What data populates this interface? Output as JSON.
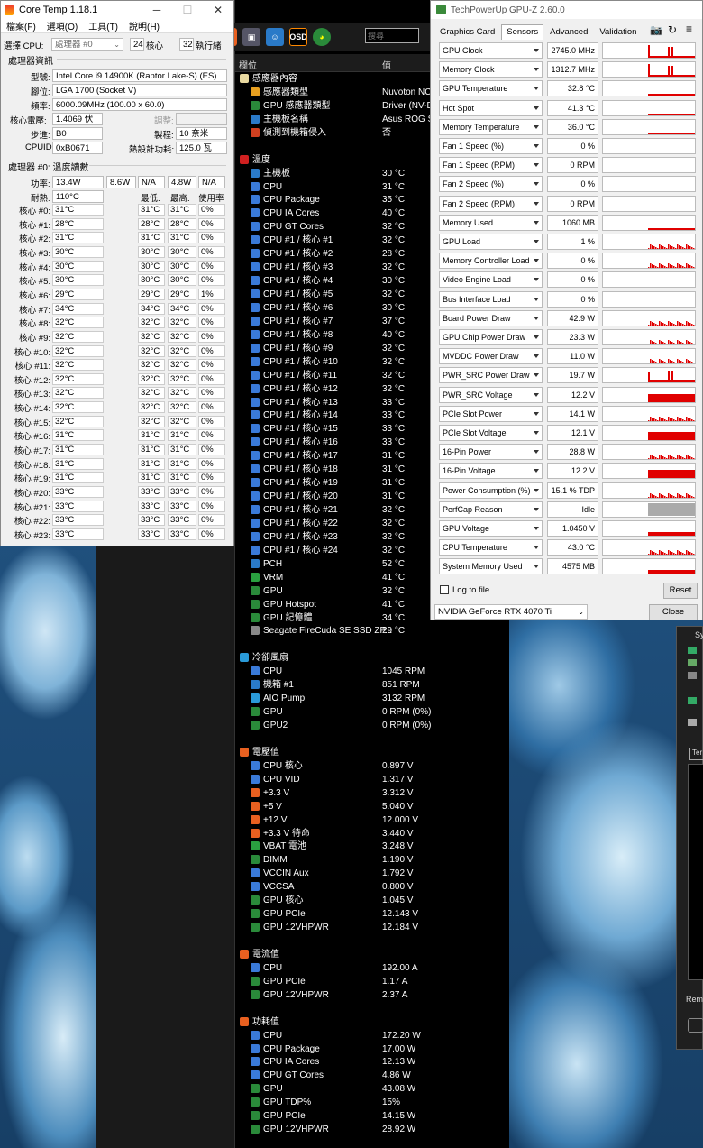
{
  "coretemp": {
    "title": "Core Temp 1.18.1",
    "menu": [
      "檔案(F)",
      "選項(O)",
      "工具(T)",
      "說明(H)"
    ],
    "select_label": "選擇 CPU:",
    "cpu_select": "處理器 #0",
    "cores": "24",
    "cores_label": "核心",
    "threads": "32",
    "threads_label": "執行緒",
    "info_header": "處理器資訊",
    "model_label": "型號:",
    "model": "Intel Core i9 14900K (Raptor Lake-S)  (ES)",
    "socket_label": "腳位:",
    "socket": "LGA 1700 (Socket V)",
    "freq_label": "頻率:",
    "freq": "6000.09MHz (100.00 x 60.0)",
    "vid_label": "核心電壓:",
    "vid": "1.4069 伏",
    "mod_label": "調整:",
    "mod": "",
    "step_label": "步進:",
    "step": "B0",
    "lith_label": "製程:",
    "lith": "10 奈米",
    "cpuid_label": "CPUID:",
    "cpuid": "0xB0671",
    "tdp_label": "熱設計功耗:",
    "tdp": "125.0 瓦",
    "temp_header": "處理器 #0: 溫度讀數",
    "power_label": "功率:",
    "power": [
      "13.4W",
      "8.6W",
      "N/A",
      "4.8W",
      "N/A"
    ],
    "tj_label": "耐熱:",
    "tj": "110°C",
    "min_label": "最低.",
    "max_label": "最高.",
    "load_label": "使用率",
    "cores_list": [
      {
        "n": "核心 #0:",
        "t": "31°C",
        "min": "31°C",
        "max": "31°C",
        "load": "0%"
      },
      {
        "n": "核心 #1:",
        "t": "28°C",
        "min": "28°C",
        "max": "28°C",
        "load": "0%"
      },
      {
        "n": "核心 #2:",
        "t": "31°C",
        "min": "31°C",
        "max": "31°C",
        "load": "0%"
      },
      {
        "n": "核心 #3:",
        "t": "30°C",
        "min": "30°C",
        "max": "30°C",
        "load": "0%"
      },
      {
        "n": "核心 #4:",
        "t": "30°C",
        "min": "30°C",
        "max": "30°C",
        "load": "0%"
      },
      {
        "n": "核心 #5:",
        "t": "30°C",
        "min": "30°C",
        "max": "30°C",
        "load": "0%"
      },
      {
        "n": "核心 #6:",
        "t": "29°C",
        "min": "29°C",
        "max": "29°C",
        "load": "1%"
      },
      {
        "n": "核心 #7:",
        "t": "34°C",
        "min": "34°C",
        "max": "34°C",
        "load": "0%"
      },
      {
        "n": "核心 #8:",
        "t": "32°C",
        "min": "32°C",
        "max": "32°C",
        "load": "0%"
      },
      {
        "n": "核心 #9:",
        "t": "32°C",
        "min": "32°C",
        "max": "32°C",
        "load": "0%"
      },
      {
        "n": "核心 #10:",
        "t": "32°C",
        "min": "32°C",
        "max": "32°C",
        "load": "0%"
      },
      {
        "n": "核心 #11:",
        "t": "32°C",
        "min": "32°C",
        "max": "32°C",
        "load": "0%"
      },
      {
        "n": "核心 #12:",
        "t": "32°C",
        "min": "32°C",
        "max": "32°C",
        "load": "0%"
      },
      {
        "n": "核心 #13:",
        "t": "32°C",
        "min": "32°C",
        "max": "32°C",
        "load": "0%"
      },
      {
        "n": "核心 #14:",
        "t": "32°C",
        "min": "32°C",
        "max": "32°C",
        "load": "0%"
      },
      {
        "n": "核心 #15:",
        "t": "32°C",
        "min": "32°C",
        "max": "32°C",
        "load": "0%"
      },
      {
        "n": "核心 #16:",
        "t": "31°C",
        "min": "31°C",
        "max": "31°C",
        "load": "0%"
      },
      {
        "n": "核心 #17:",
        "t": "31°C",
        "min": "31°C",
        "max": "31°C",
        "load": "0%"
      },
      {
        "n": "核心 #18:",
        "t": "31°C",
        "min": "31°C",
        "max": "31°C",
        "load": "0%"
      },
      {
        "n": "核心 #19:",
        "t": "31°C",
        "min": "31°C",
        "max": "31°C",
        "load": "0%"
      },
      {
        "n": "核心 #20:",
        "t": "33°C",
        "min": "33°C",
        "max": "33°C",
        "load": "0%"
      },
      {
        "n": "核心 #21:",
        "t": "33°C",
        "min": "33°C",
        "max": "33°C",
        "load": "0%"
      },
      {
        "n": "核心 #22:",
        "t": "33°C",
        "min": "33°C",
        "max": "33°C",
        "load": "0%"
      },
      {
        "n": "核心 #23:",
        "t": "33°C",
        "min": "33°C",
        "max": "33°C",
        "load": "0%"
      }
    ]
  },
  "hwinfo": {
    "search_placeholder": "搜尋",
    "col_field": "欄位",
    "col_value": "值",
    "toolbar_icons": [
      "flame-icon",
      "computer-icon",
      "user-icon",
      "osd-icon",
      "globe-icon"
    ],
    "osd_label": "OSD",
    "rows": [
      {
        "s": 1,
        "l": "感應器內容",
        "v": "",
        "c": "#e8d9a0"
      },
      {
        "l": "感應器類型",
        "v": "Nuvoton NC",
        "c": "#e8a020"
      },
      {
        "l": "GPU 感應器類型",
        "v": "Driver (NV-D",
        "c": "#2a8a3a"
      },
      {
        "l": "主機板名稱",
        "v": "Asus ROG St",
        "c": "#2a7ac8"
      },
      {
        "l": "偵測到機箱侵入",
        "v": "否",
        "c": "#d04020"
      },
      {
        "gap": 1
      },
      {
        "s": 1,
        "l": "溫度",
        "v": "",
        "c": "#d02020"
      },
      {
        "l": "主機板",
        "v": "30 °C",
        "c": "#2a7ac8"
      },
      {
        "l": "CPU",
        "v": "31 °C",
        "c": "#3a7ad8"
      },
      {
        "l": "CPU Package",
        "v": "35 °C",
        "c": "#3a7ad8"
      },
      {
        "l": "CPU IA Cores",
        "v": "40 °C",
        "c": "#3a7ad8"
      },
      {
        "l": "CPU GT Cores",
        "v": "32 °C",
        "c": "#3a7ad8"
      },
      {
        "l": "CPU #1 / 核心 #1",
        "v": "32 °C",
        "c": "#3a7ad8"
      },
      {
        "l": "CPU #1 / 核心 #2",
        "v": "28 °C",
        "c": "#3a7ad8"
      },
      {
        "l": "CPU #1 / 核心 #3",
        "v": "32 °C",
        "c": "#3a7ad8"
      },
      {
        "l": "CPU #1 / 核心 #4",
        "v": "30 °C",
        "c": "#3a7ad8"
      },
      {
        "l": "CPU #1 / 核心 #5",
        "v": "32 °C",
        "c": "#3a7ad8"
      },
      {
        "l": "CPU #1 / 核心 #6",
        "v": "30 °C",
        "c": "#3a7ad8"
      },
      {
        "l": "CPU #1 / 核心 #7",
        "v": "37 °C",
        "c": "#3a7ad8"
      },
      {
        "l": "CPU #1 / 核心 #8",
        "v": "40 °C",
        "c": "#3a7ad8"
      },
      {
        "l": "CPU #1 / 核心 #9",
        "v": "32 °C",
        "c": "#3a7ad8"
      },
      {
        "l": "CPU #1 / 核心 #10",
        "v": "32 °C",
        "c": "#3a7ad8"
      },
      {
        "l": "CPU #1 / 核心 #11",
        "v": "32 °C",
        "c": "#3a7ad8"
      },
      {
        "l": "CPU #1 / 核心 #12",
        "v": "32 °C",
        "c": "#3a7ad8"
      },
      {
        "l": "CPU #1 / 核心 #13",
        "v": "33 °C",
        "c": "#3a7ad8"
      },
      {
        "l": "CPU #1 / 核心 #14",
        "v": "33 °C",
        "c": "#3a7ad8"
      },
      {
        "l": "CPU #1 / 核心 #15",
        "v": "33 °C",
        "c": "#3a7ad8"
      },
      {
        "l": "CPU #1 / 核心 #16",
        "v": "33 °C",
        "c": "#3a7ad8"
      },
      {
        "l": "CPU #1 / 核心 #17",
        "v": "31 °C",
        "c": "#3a7ad8"
      },
      {
        "l": "CPU #1 / 核心 #18",
        "v": "31 °C",
        "c": "#3a7ad8"
      },
      {
        "l": "CPU #1 / 核心 #19",
        "v": "31 °C",
        "c": "#3a7ad8"
      },
      {
        "l": "CPU #1 / 核心 #20",
        "v": "31 °C",
        "c": "#3a7ad8"
      },
      {
        "l": "CPU #1 / 核心 #21",
        "v": "32 °C",
        "c": "#3a7ad8"
      },
      {
        "l": "CPU #1 / 核心 #22",
        "v": "32 °C",
        "c": "#3a7ad8"
      },
      {
        "l": "CPU #1 / 核心 #23",
        "v": "32 °C",
        "c": "#3a7ad8"
      },
      {
        "l": "CPU #1 / 核心 #24",
        "v": "32 °C",
        "c": "#3a7ad8"
      },
      {
        "l": "PCH",
        "v": "52 °C",
        "c": "#2a7ac8"
      },
      {
        "l": "VRM",
        "v": "41 °C",
        "c": "#2aa040"
      },
      {
        "l": "GPU",
        "v": "32 °C",
        "c": "#2a8a3a"
      },
      {
        "l": "GPU Hotspot",
        "v": "41 °C",
        "c": "#2a8a3a"
      },
      {
        "l": "GPU 記憶體",
        "v": "34 °C",
        "c": "#2a8a3a"
      },
      {
        "l": "Seagate FireCuda SE SSD ZP...",
        "v": "29 °C",
        "c": "#888"
      },
      {
        "gap": 1
      },
      {
        "s": 1,
        "l": "冷卻風扇",
        "v": "",
        "c": "#2a9ad8"
      },
      {
        "l": "CPU",
        "v": "1045 RPM",
        "c": "#3a7ad8"
      },
      {
        "l": "機箱 #1",
        "v": "851 RPM",
        "c": "#2a7ac8"
      },
      {
        "l": "AIO Pump",
        "v": "3132 RPM",
        "c": "#2a9ad8"
      },
      {
        "l": "GPU",
        "v": "0 RPM  (0%)",
        "c": "#2a8a3a"
      },
      {
        "l": "GPU2",
        "v": "0 RPM  (0%)",
        "c": "#2a8a3a"
      },
      {
        "gap": 1
      },
      {
        "s": 1,
        "l": "電壓值",
        "v": "",
        "c": "#e86020"
      },
      {
        "l": "CPU 核心",
        "v": "0.897 V",
        "c": "#3a7ad8"
      },
      {
        "l": "CPU VID",
        "v": "1.317 V",
        "c": "#3a7ad8"
      },
      {
        "l": "+3.3 V",
        "v": "3.312 V",
        "c": "#e86020"
      },
      {
        "l": "+5 V",
        "v": "5.040 V",
        "c": "#e86020"
      },
      {
        "l": "+12 V",
        "v": "12.000 V",
        "c": "#e86020"
      },
      {
        "l": "+3.3 V 待命",
        "v": "3.440 V",
        "c": "#e86020"
      },
      {
        "l": "VBAT 電池",
        "v": "3.248 V",
        "c": "#2aa040"
      },
      {
        "l": "DIMM",
        "v": "1.190 V",
        "c": "#2a8a3a"
      },
      {
        "l": "VCCIN Aux",
        "v": "1.792 V",
        "c": "#3a7ad8"
      },
      {
        "l": "VCCSA",
        "v": "0.800 V",
        "c": "#3a7ad8"
      },
      {
        "l": "GPU 核心",
        "v": "1.045 V",
        "c": "#2a8a3a"
      },
      {
        "l": "GPU PCIe",
        "v": "12.143 V",
        "c": "#2a8a3a"
      },
      {
        "l": "GPU 12VHPWR",
        "v": "12.184 V",
        "c": "#2a8a3a"
      },
      {
        "gap": 1
      },
      {
        "s": 1,
        "l": "電流值",
        "v": "",
        "c": "#e86020"
      },
      {
        "l": "CPU",
        "v": "192.00 A",
        "c": "#3a7ad8"
      },
      {
        "l": "GPU PCIe",
        "v": "1.17 A",
        "c": "#2a8a3a"
      },
      {
        "l": "GPU 12VHPWR",
        "v": "2.37 A",
        "c": "#2a8a3a"
      },
      {
        "gap": 1
      },
      {
        "s": 1,
        "l": "功耗值",
        "v": "",
        "c": "#e86020"
      },
      {
        "l": "CPU",
        "v": "172.20 W",
        "c": "#3a7ad8"
      },
      {
        "l": "CPU Package",
        "v": "17.00 W",
        "c": "#3a7ad8"
      },
      {
        "l": "CPU IA Cores",
        "v": "12.13 W",
        "c": "#3a7ad8"
      },
      {
        "l": "CPU GT Cores",
        "v": "4.86 W",
        "c": "#3a7ad8"
      },
      {
        "l": "GPU",
        "v": "43.08 W",
        "c": "#2a8a3a"
      },
      {
        "l": "GPU TDP%",
        "v": "15%",
        "c": "#2a8a3a"
      },
      {
        "l": "GPU PCIe",
        "v": "14.15 W",
        "c": "#2a8a3a"
      },
      {
        "l": "GPU 12VHPWR",
        "v": "28.92 W",
        "c": "#2a8a3a"
      }
    ]
  },
  "gpuz": {
    "title": "TechPowerUp GPU-Z 2.60.0",
    "tabs": [
      "Graphics Card",
      "Sensors",
      "Advanced",
      "Validation"
    ],
    "sensors": [
      {
        "n": "GPU Clock",
        "v": "2745.0 MHz",
        "g": "spike"
      },
      {
        "n": "Memory Clock",
        "v": "1312.7 MHz",
        "g": "spike"
      },
      {
        "n": "GPU Temperature",
        "v": "32.8 °C",
        "g": "low"
      },
      {
        "n": "Hot Spot",
        "v": "41.3 °C",
        "g": "low"
      },
      {
        "n": "Memory Temperature",
        "v": "36.0 °C",
        "g": "low"
      },
      {
        "n": "Fan 1 Speed (%)",
        "v": "0 %",
        "g": "none"
      },
      {
        "n": "Fan 1 Speed (RPM)",
        "v": "0 RPM",
        "g": "none"
      },
      {
        "n": "Fan 2 Speed (%)",
        "v": "0 %",
        "g": "none"
      },
      {
        "n": "Fan 2 Speed (RPM)",
        "v": "0 RPM",
        "g": "none"
      },
      {
        "n": "Memory Used",
        "v": "1060 MB",
        "g": "low"
      },
      {
        "n": "GPU Load",
        "v": "1 %",
        "g": "noise"
      },
      {
        "n": "Memory Controller Load",
        "v": "0 %",
        "g": "noise"
      },
      {
        "n": "Video Engine Load",
        "v": "0 %",
        "g": "none"
      },
      {
        "n": "Bus Interface Load",
        "v": "0 %",
        "g": "none"
      },
      {
        "n": "Board Power Draw",
        "v": "42.9 W",
        "g": "noise"
      },
      {
        "n": "GPU Chip Power Draw",
        "v": "23.3 W",
        "g": "noise"
      },
      {
        "n": "MVDDC Power Draw",
        "v": "11.0 W",
        "g": "noise"
      },
      {
        "n": "PWR_SRC Power Draw",
        "v": "19.7 W",
        "g": "spike2"
      },
      {
        "n": "PWR_SRC Voltage",
        "v": "12.2 V",
        "g": "half"
      },
      {
        "n": "PCIe Slot Power",
        "v": "14.1 W",
        "g": "noise"
      },
      {
        "n": "PCIe Slot Voltage",
        "v": "12.1 V",
        "g": "half"
      },
      {
        "n": "16-Pin Power",
        "v": "28.8 W",
        "g": "noise"
      },
      {
        "n": "16-Pin Voltage",
        "v": "12.2 V",
        "g": "half"
      },
      {
        "n": "Power Consumption (%)",
        "v": "15.1 % TDP",
        "g": "noise"
      },
      {
        "n": "PerfCap Reason",
        "v": "Idle",
        "g": "gray"
      },
      {
        "n": "GPU Voltage",
        "v": "1.0450 V",
        "g": "third"
      },
      {
        "n": "CPU Temperature",
        "v": "43.0 °C",
        "g": "noise2"
      },
      {
        "n": "System Memory Used",
        "v": "4575 MB",
        "g": "low2"
      }
    ],
    "log_label": "Log to file",
    "reset": "Reset",
    "device": "NVIDIA GeForce RTX 4070 Ti",
    "close": "Close"
  },
  "side": {
    "title": "Sy",
    "tab_label": "Ter",
    "bottom_text": "Rem"
  },
  "colors": {
    "graph": "#e00000",
    "accent": "#e00000"
  }
}
